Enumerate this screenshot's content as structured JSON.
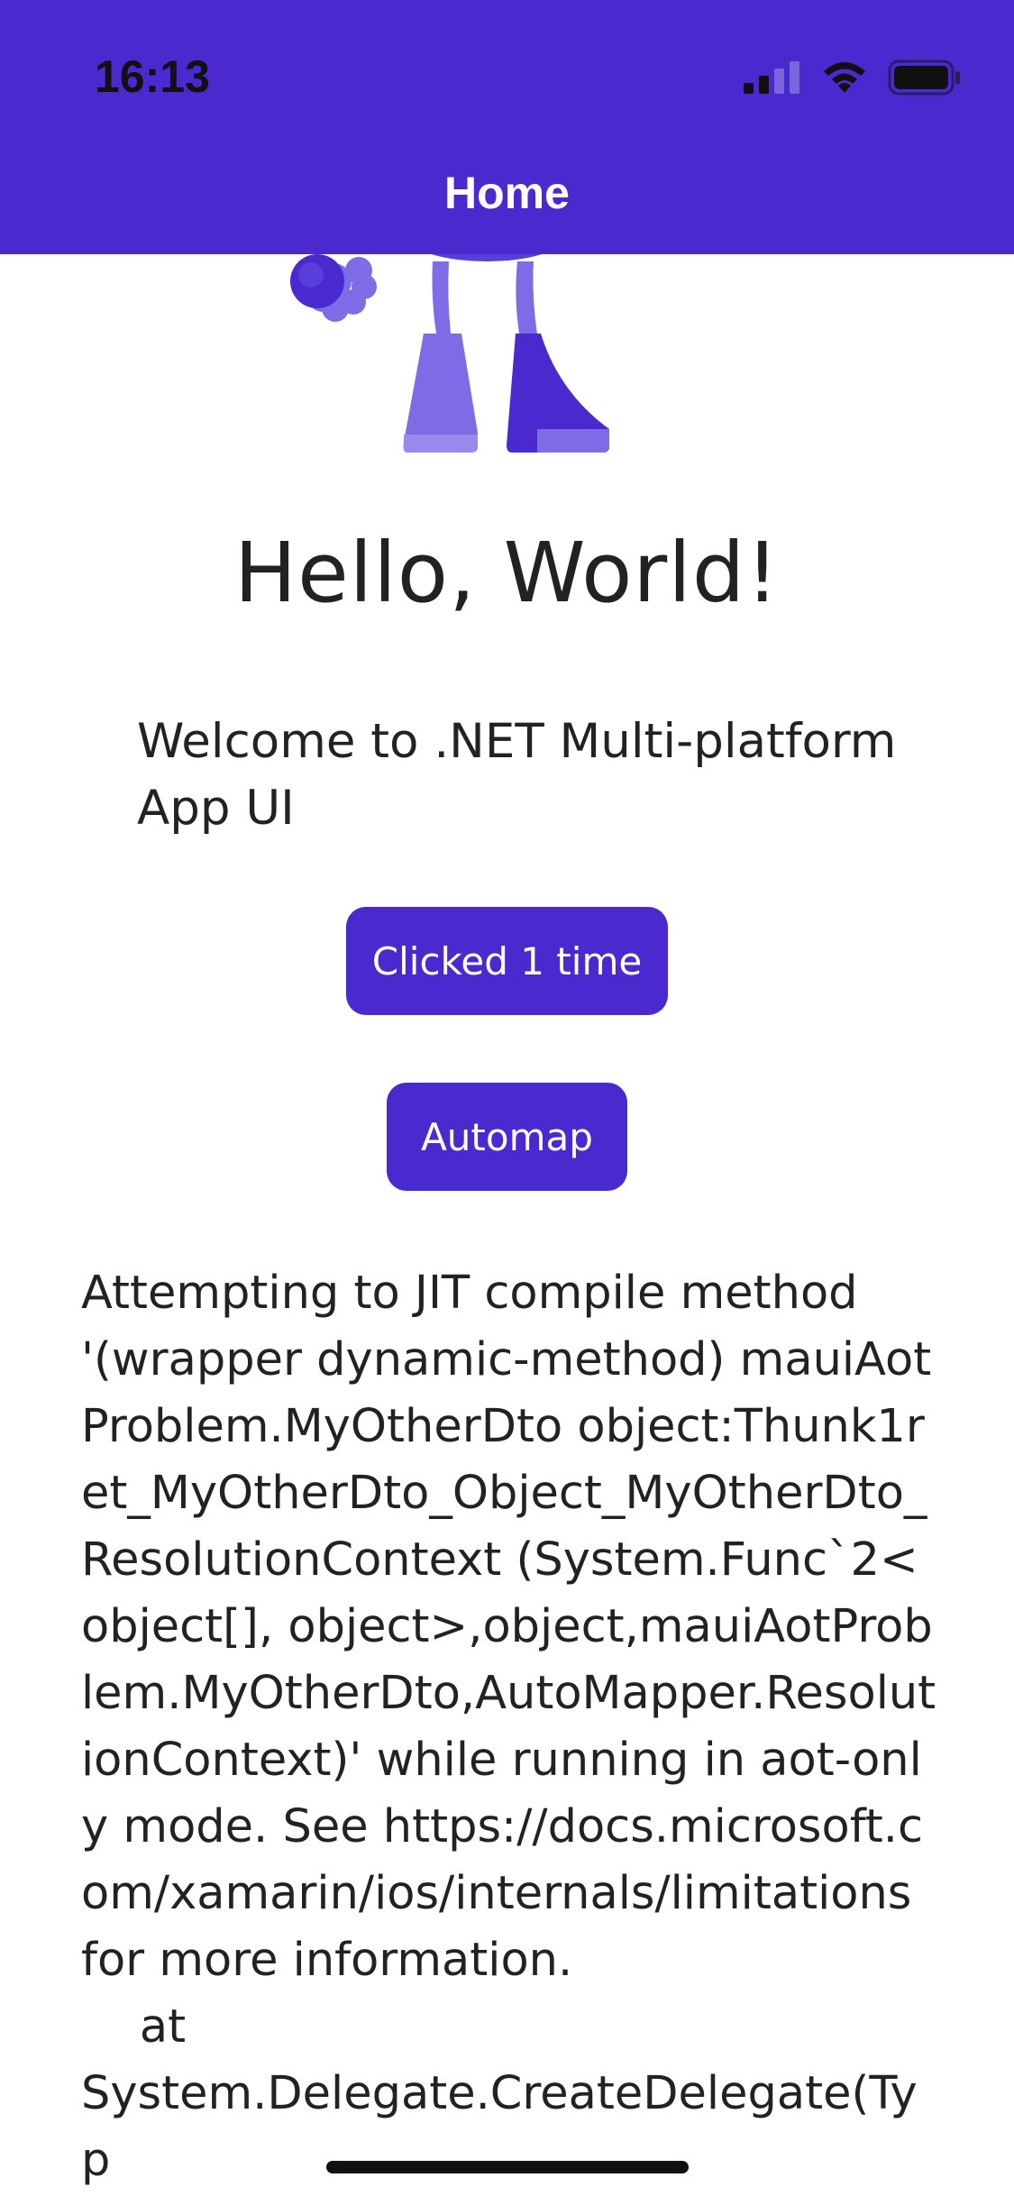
{
  "colors": {
    "accent": "#4A2ACF",
    "text": "#222222",
    "background": "#FFFFFF",
    "bot_light": "#7E6BE6",
    "bot_dark": "#5A3ED9"
  },
  "status_bar": {
    "time": "16:13",
    "icons": [
      "cellular-signal-icon",
      "wifi-icon",
      "battery-icon"
    ]
  },
  "nav_bar": {
    "title": "Home"
  },
  "hero": {
    "image": "dotnet-bot-illustration"
  },
  "main": {
    "greeting": "Hello, World!",
    "welcome": "Welcome to .NET Multi-platform App UI",
    "counter_button": "Clicked 1 time",
    "automap_button": "Automap",
    "error_text": "Attempting to JIT compile method '(wrapper dynamic-method) mauiAotProblem.MyOtherDto object:Thunk1ret_MyOtherDto_Object_MyOtherDto_ResolutionContext (System.Func`2<object[], object>,object,mauiAotProblem.MyOtherDto,AutoMapper.ResolutionContext)' while running in aot-only mode. See https://docs.microsoft.com/xamarin/ios/internals/limitations for more information.\n    at\nSystem.Delegate.CreateDelegate(Typ"
  }
}
